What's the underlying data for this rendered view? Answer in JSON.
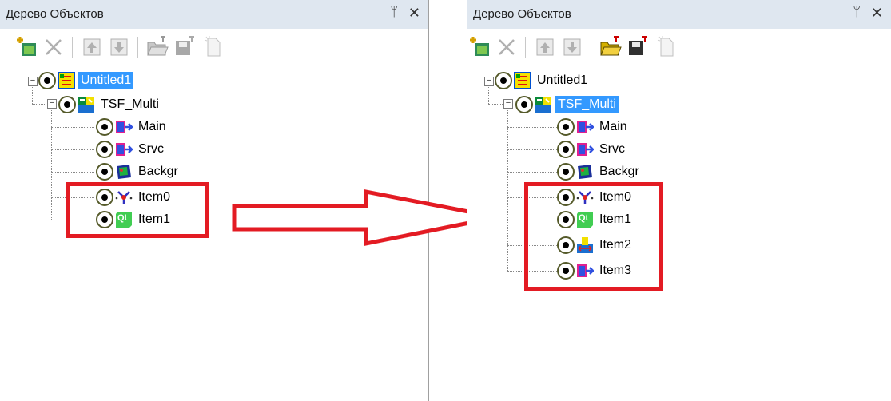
{
  "left_panel": {
    "title": "Дерево Объектов",
    "pin_glyph": "ᛘ",
    "close_glyph": "✕",
    "tree": {
      "root": {
        "label": "Untitled1",
        "icon": "project-icon",
        "selected": true
      },
      "group": {
        "label": "TSF_Multi",
        "icon": "multi-icon",
        "selected": false
      },
      "children": [
        {
          "label": "Main",
          "icon": "arrow-item-icon"
        },
        {
          "label": "Srvc",
          "icon": "arrow-item-icon"
        },
        {
          "label": "Backgr",
          "icon": "film-icon"
        },
        {
          "label": "Item0",
          "icon": "connector-icon"
        },
        {
          "label": "Item1",
          "icon": "qt-icon"
        }
      ]
    }
  },
  "right_panel": {
    "title": "Дерево Объектов",
    "pin_glyph": "ᛘ",
    "close_glyph": "✕",
    "tree": {
      "root": {
        "label": "Untitled1",
        "icon": "project-icon",
        "selected": false
      },
      "group": {
        "label": "TSF_Multi",
        "icon": "multi-icon",
        "selected": true
      },
      "children": [
        {
          "label": "Main",
          "icon": "arrow-item-icon"
        },
        {
          "label": "Srvc",
          "icon": "arrow-item-icon"
        },
        {
          "label": "Backgr",
          "icon": "film-icon"
        },
        {
          "label": "Item0",
          "icon": "connector-icon"
        },
        {
          "label": "Item1",
          "icon": "qt-icon"
        },
        {
          "label": "Item2",
          "icon": "scale-icon"
        },
        {
          "label": "Item3",
          "icon": "arrow-item-icon"
        }
      ]
    }
  },
  "annotation": {
    "arrow_color": "#e31b23",
    "box_color": "#e31b23"
  },
  "qt_text": "Qt"
}
